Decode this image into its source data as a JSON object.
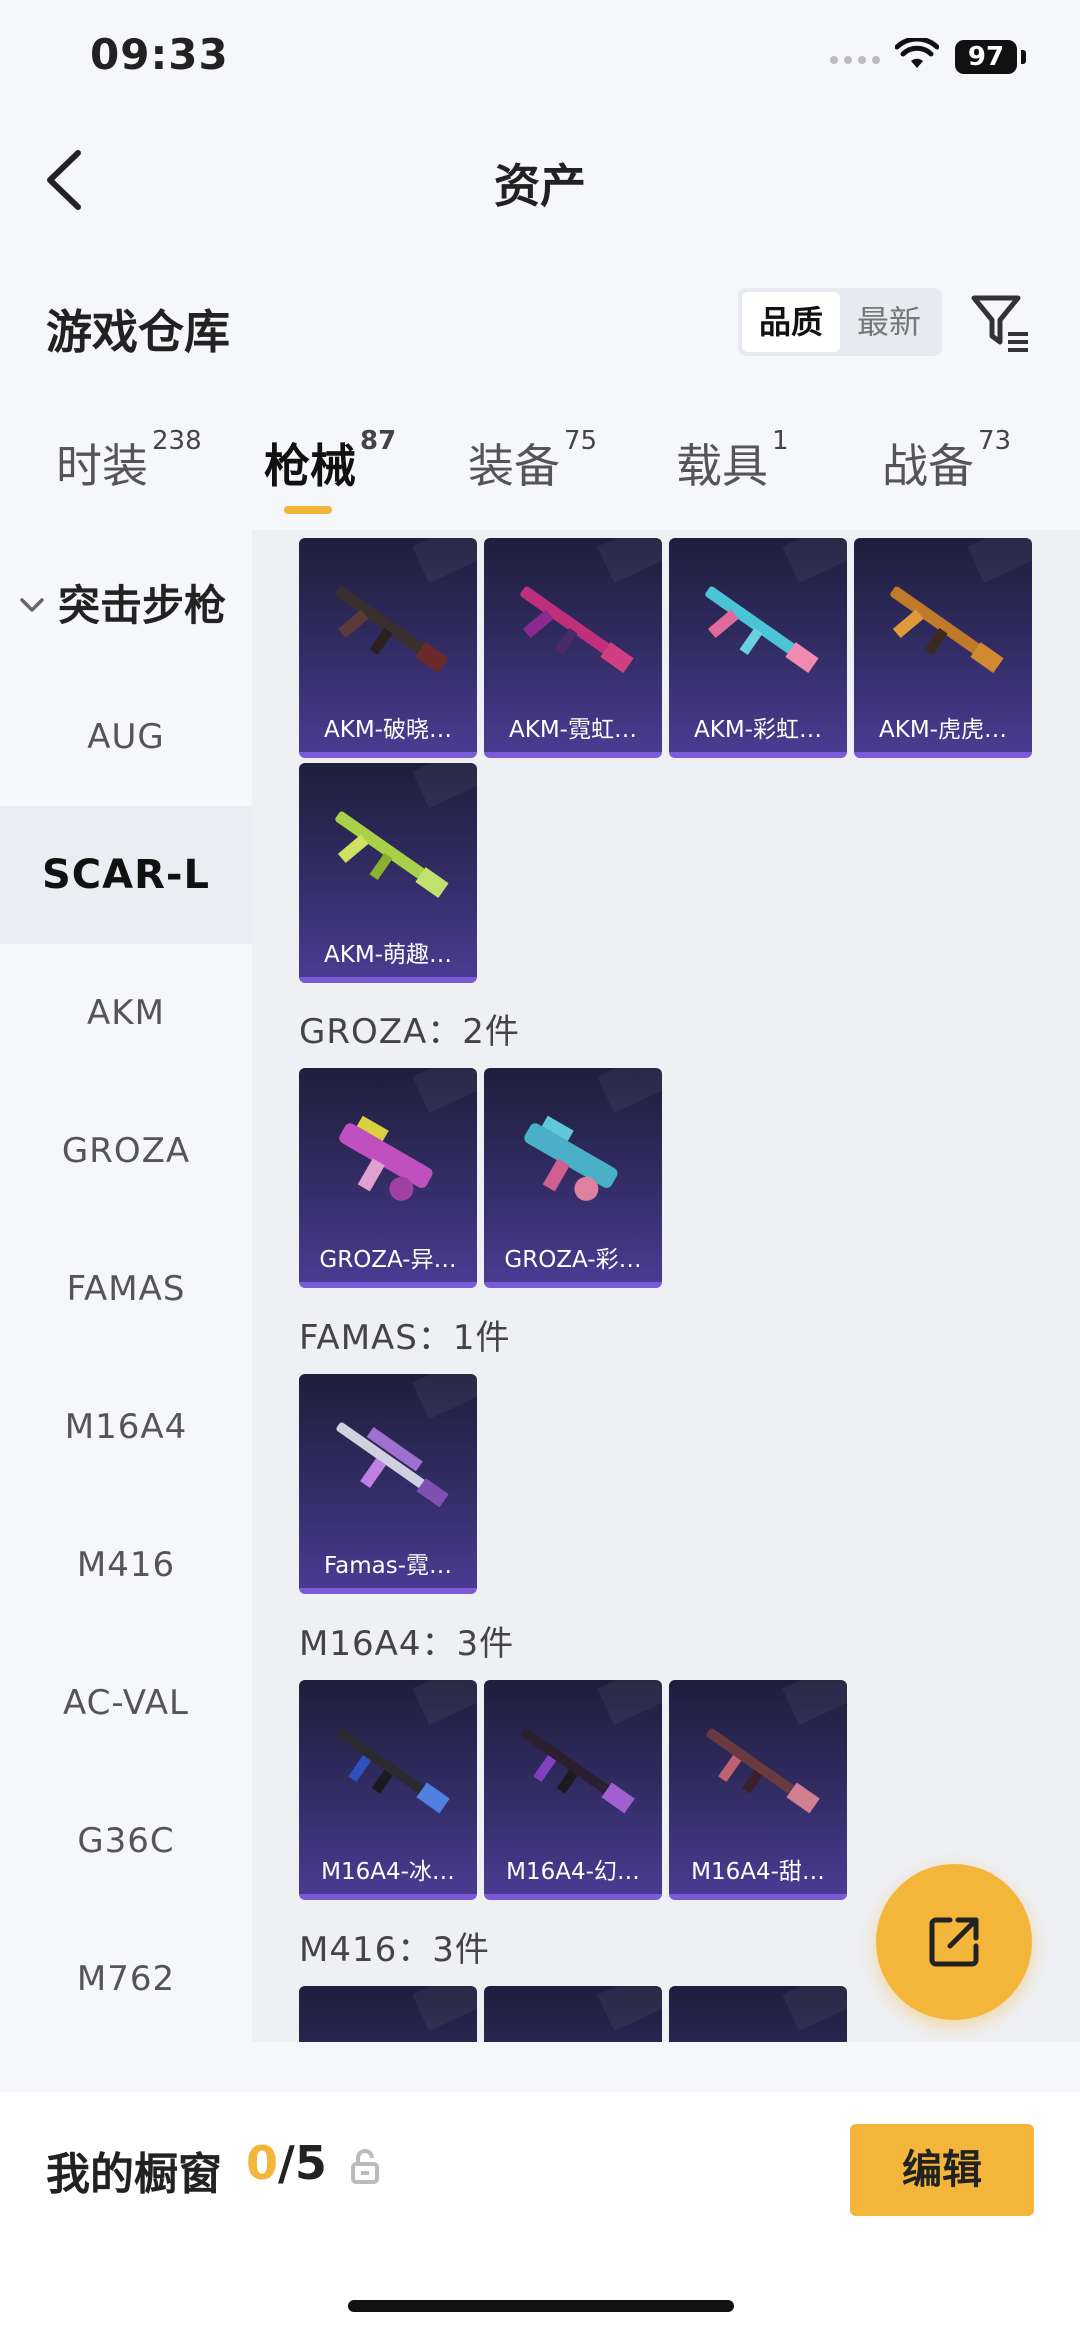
{
  "status": {
    "time": "09:33",
    "battery": "97"
  },
  "nav": {
    "title": "资产"
  },
  "header": {
    "title": "游戏仓库",
    "sort_options": [
      "品质",
      "最新"
    ]
  },
  "tabs": [
    {
      "label": "时装",
      "count": "238"
    },
    {
      "label": "枪械",
      "count": "87"
    },
    {
      "label": "装备",
      "count": "75"
    },
    {
      "label": "载具",
      "count": "1"
    },
    {
      "label": "战备",
      "count": "73"
    }
  ],
  "side": {
    "group": "突击步枪",
    "items": [
      "AUG",
      "SCAR-L",
      "AKM",
      "GROZA",
      "FAMAS",
      "M16A4",
      "M416",
      "AC-VAL",
      "G36C",
      "M762"
    ]
  },
  "sections": {
    "akm": {
      "items": [
        "AKM-破晓…",
        "AKM-霓虹…",
        "AKM-彩虹…",
        "AKM-虎虎…",
        "AKM-萌趣…"
      ]
    },
    "groza": {
      "title": "GROZA：2件",
      "items": [
        "GROZA-异…",
        "GROZA-彩…"
      ]
    },
    "famas": {
      "title": "FAMAS：1件",
      "items": [
        "Famas-霓…"
      ]
    },
    "m16a4": {
      "title": "M16A4：3件",
      "items": [
        "M16A4-冰…",
        "M16A4-幻…",
        "M16A4-甜…"
      ]
    },
    "m416": {
      "title": "M416：3件"
    }
  },
  "bottom": {
    "showcase_label": "我的橱窗",
    "used": "0",
    "total": "/5",
    "edit_label": "编辑"
  },
  "colors": {
    "accent": "#f4b63a",
    "card_bg": "#2f2a5e"
  }
}
